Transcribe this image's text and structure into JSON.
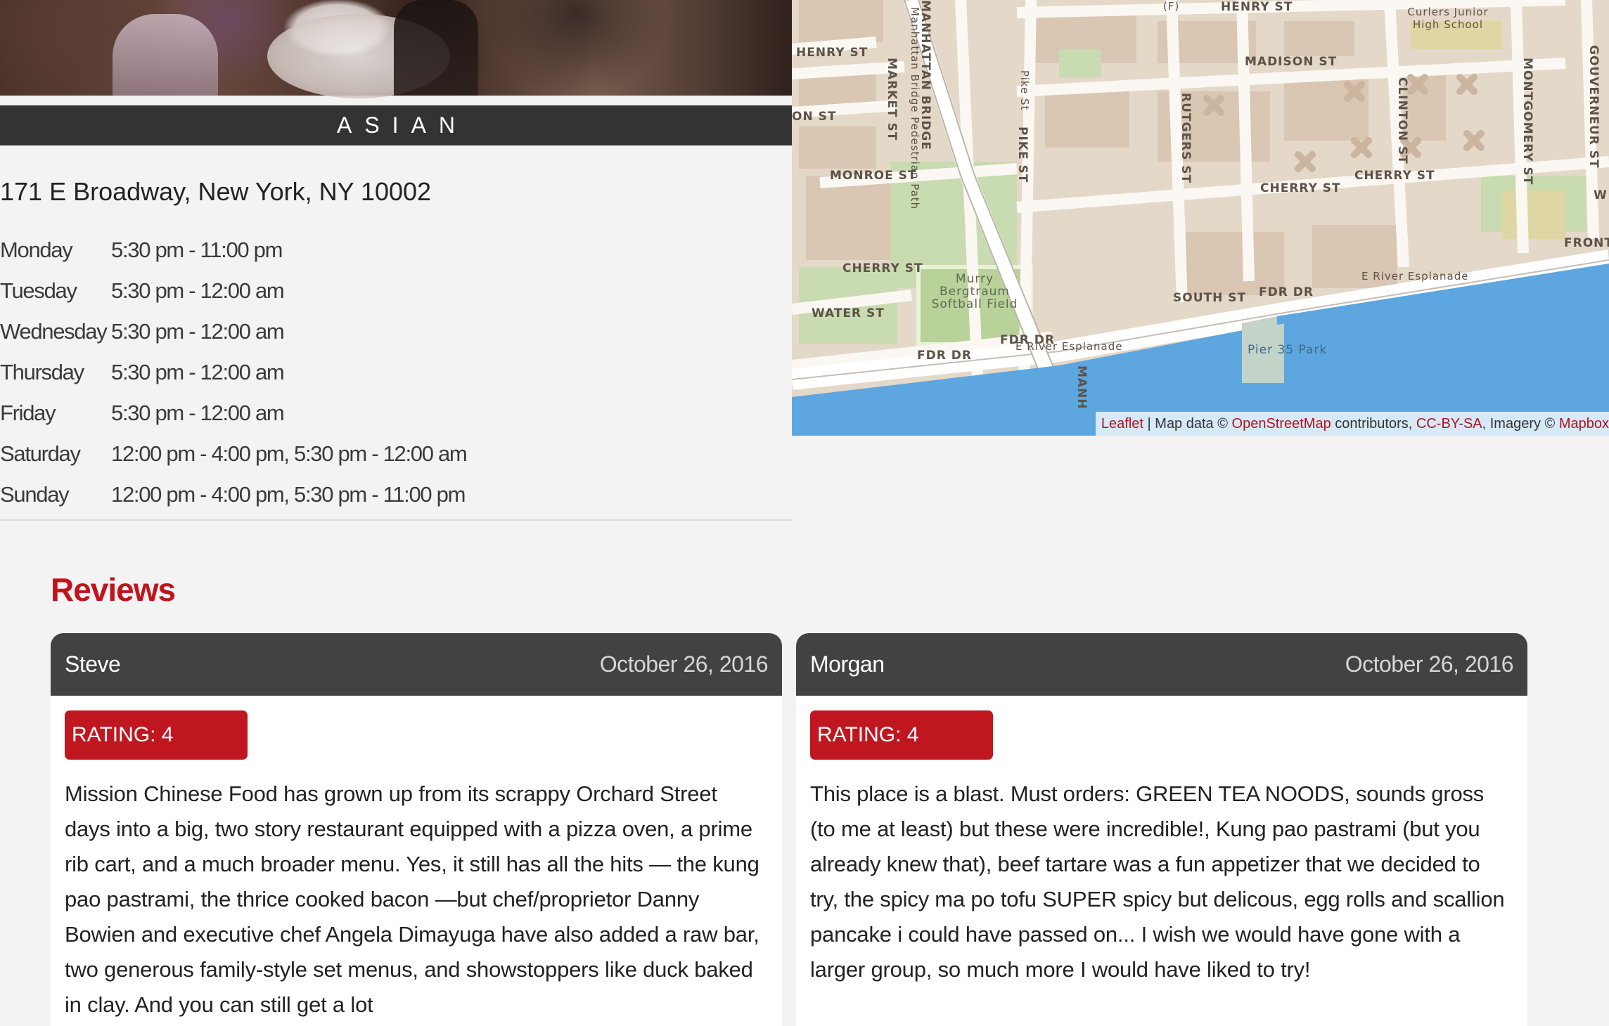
{
  "restaurant": {
    "cuisine": "ASIAN",
    "address": "171 E Broadway, New York, NY 10002",
    "hours": [
      {
        "day": "Monday",
        "time": "5:30 pm - 11:00 pm"
      },
      {
        "day": "Tuesday",
        "time": "5:30 pm - 12:00 am"
      },
      {
        "day": "Wednesday",
        "time": "5:30 pm - 12:00 am"
      },
      {
        "day": "Thursday",
        "time": "5:30 pm - 12:00 am"
      },
      {
        "day": "Friday",
        "time": "5:30 pm - 12:00 am"
      },
      {
        "day": "Saturday",
        "time": "12:00 pm - 4:00 pm, 5:30 pm - 12:00 am"
      },
      {
        "day": "Sunday",
        "time": "12:00 pm - 4:00 pm, 5:30 pm - 11:00 pm"
      }
    ]
  },
  "map": {
    "labels": {
      "henry_st_top": "HENRY ST",
      "henry_st_left": "HENRY ST",
      "on_st": "ON ST",
      "market_st": "MARKET ST",
      "manhattan_bridge": "MANHATTAN BRIDGE",
      "bridge_path": "Manhattan Bridge Pedestrian Path",
      "pike_st_small": "Pike St",
      "pike_st": "PIKE ST",
      "madison_st": "MADISON ST",
      "curlers_school": "Curlers Junior High School",
      "rutgers_st": "RUTGERS ST",
      "clinton_st": "CLINTON ST",
      "montgomery_st": "MONTGOMERY ST",
      "gouverneur_st": "GOUVERNEUR ST",
      "monroe_st": "MONROE ST",
      "cherry_st_left": "CHERRY ST",
      "cherry_st_mid": "CHERRY ST",
      "cherry_st_right": "CHERRY ST",
      "water_st": "WATER ST",
      "softball_field": "Murry Bergtraum Softball Field",
      "south_st": "SOUTH ST",
      "fdr_dr_1": "FDR DR",
      "fdr_dr_2": "FDR DR",
      "fdr_dr_3": "FDR DR",
      "e_river_esplanade_1": "E River Esplanade",
      "e_river_esplanade_2": "E River Esplanade",
      "pier_35": "Pier 35 Park",
      "front_st": "FRONT",
      "manh": "MANH",
      "f_train": "(F)",
      "w": "W"
    },
    "attribution": {
      "leaflet": "Leaflet",
      "sep": " | Map data © ",
      "osm": "OpenStreetMap",
      "contributors": " contributors, ",
      "ccbysa": "CC-BY-SA",
      "imagery": ", Imagery © ",
      "mapbox": "Mapbox"
    },
    "link_color": "#b3121d"
  },
  "reviews": {
    "title": "Reviews",
    "items": [
      {
        "author": "Steve",
        "date": "October 26, 2016",
        "rating": "RATING: 4",
        "text": "Mission Chinese Food has grown up from its scrappy Orchard Street days into a big, two story restaurant equipped with a pizza oven, a prime rib cart, and a much broader menu. Yes, it still has all the hits — the kung pao pastrami, the thrice cooked bacon —but chef/proprietor Danny Bowien and executive chef Angela Dimayuga have also added a raw bar, two generous family-style set menus, and showstoppers like duck baked in clay. And you can still get a lot"
      },
      {
        "author": "Morgan",
        "date": "October 26, 2016",
        "rating": "RATING: 4",
        "text": "This place is a blast. Must orders: GREEN TEA NOODS, sounds gross (to me at least) but these were incredible!, Kung pao pastrami (but you already knew that), beef tartare was a fun appetizer that we decided to try, the spicy ma po tofu SUPER spicy but delicous, egg rolls and scallion pancake i could have passed on... I wish we would have gone with a larger group, so much more I would have liked to try!"
      }
    ]
  },
  "colors": {
    "accent_red": "#c0141d",
    "dark_bar": "#333333",
    "card_header": "#424242",
    "background": "#f3f3f3"
  }
}
